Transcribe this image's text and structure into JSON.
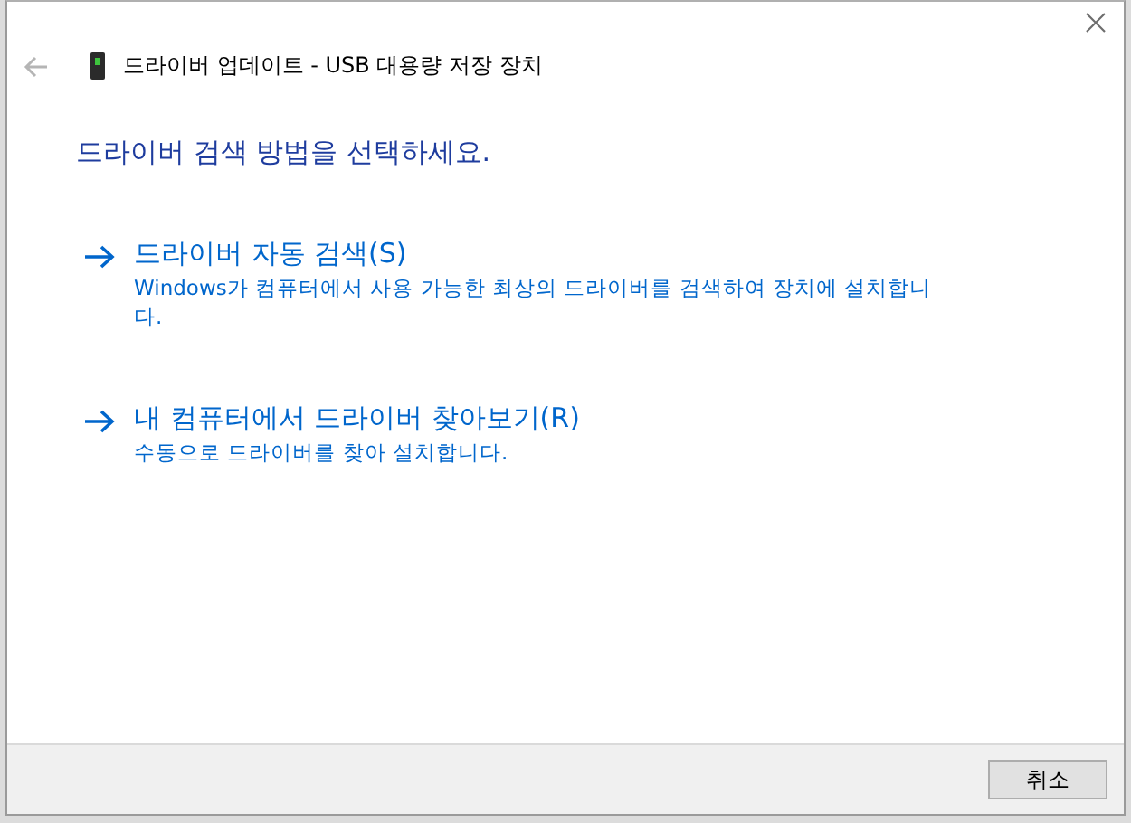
{
  "dialog": {
    "title": "드라이버 업데이트 - USB 대용량 저장 장치",
    "back_enabled": false
  },
  "heading": "드라이버 검색 방법을 선택하세요.",
  "options": [
    {
      "title": "드라이버 자동 검색(S)",
      "description": "Windows가 컴퓨터에서 사용 가능한 최상의 드라이버를 검색하여 장치에 설치합니다."
    },
    {
      "title": "내 컴퓨터에서 드라이버 찾아보기(R)",
      "description": "수동으로 드라이버를 찾아 설치합니다."
    }
  ],
  "buttons": [
    "취소"
  ]
}
